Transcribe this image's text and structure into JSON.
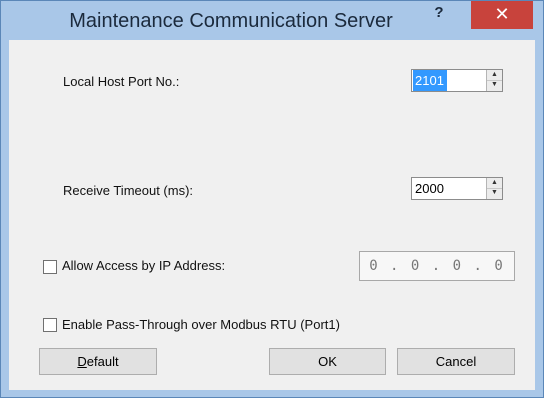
{
  "window": {
    "title": "Maintenance Communication Server",
    "help_glyph": "?",
    "close_glyph": "✕"
  },
  "local_port": {
    "label": "Local Host Port No.:",
    "value": "2101"
  },
  "receive_timeout": {
    "label": "Receive Timeout (ms):",
    "value": "2000"
  },
  "allow_access": {
    "label": "Allow Access by IP Address:",
    "checked": false,
    "ip_value": "0 . 0 . 0 . 0"
  },
  "pass_through": {
    "label": "Enable Pass-Through over Modbus RTU (Port1)",
    "checked": false
  },
  "buttons": {
    "default_first": "D",
    "default_rest": "efault",
    "ok": "OK",
    "cancel": "Cancel"
  },
  "icons": {
    "spin_up": "up-arrow-icon",
    "spin_down": "down-arrow-icon"
  }
}
